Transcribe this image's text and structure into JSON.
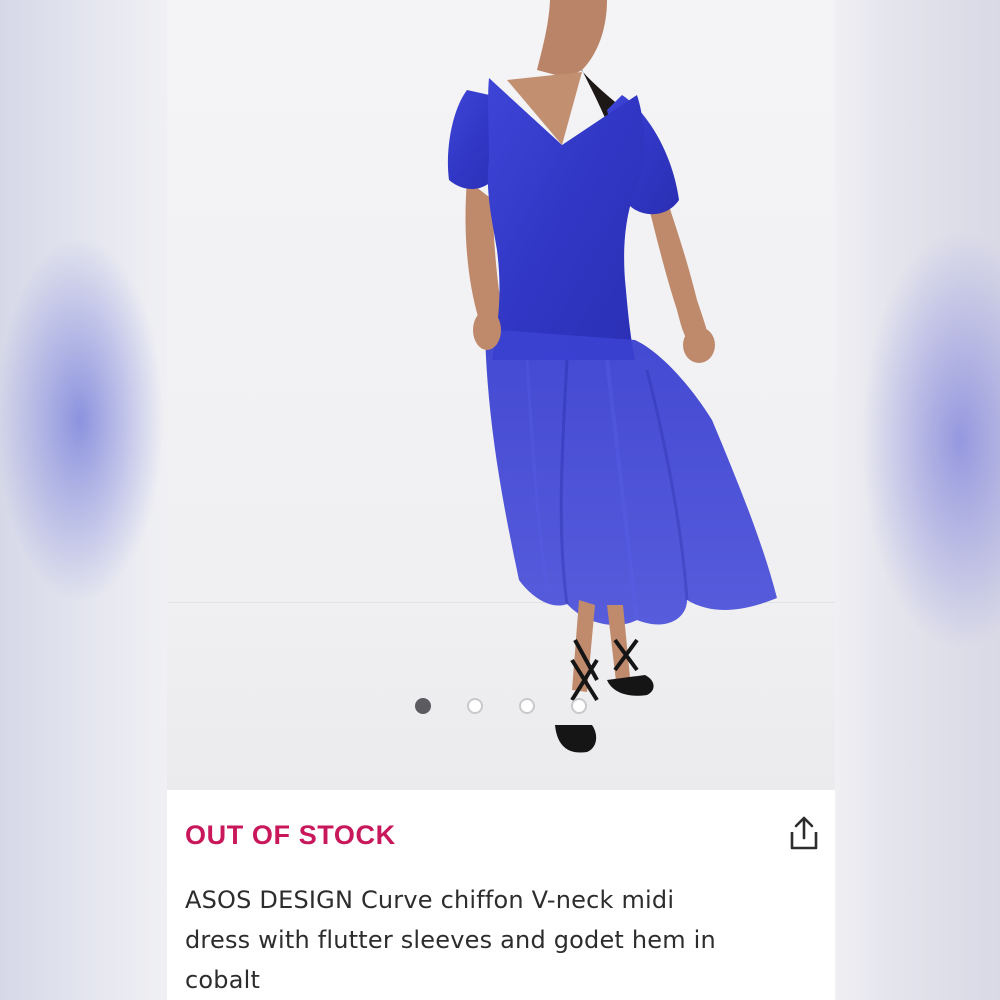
{
  "product": {
    "image_alt": "Model wearing cobalt chiffon V-neck midi dress",
    "gallery": {
      "count": 4,
      "active_index": 0
    },
    "stock_status": "OUT OF STOCK",
    "title": "ASOS DESIGN Curve chiffon V-neck midi dress with flutter sleeves and godet hem in cobalt",
    "share_icon": "share-icon"
  },
  "colors": {
    "stock_status": "#c8175a",
    "dress": "#3a3fcf",
    "active_dot": "#5c5c60"
  }
}
